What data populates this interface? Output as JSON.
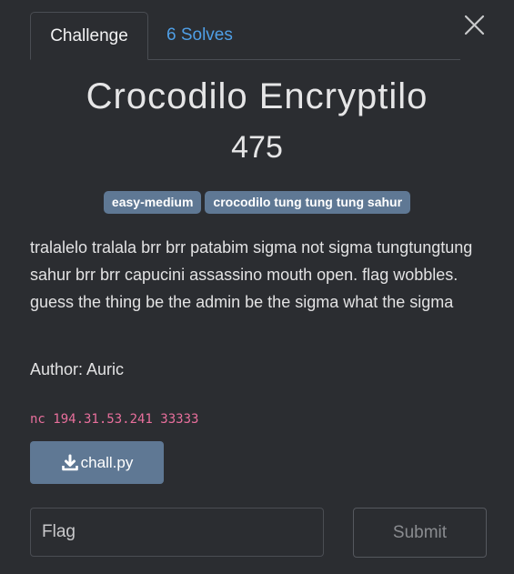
{
  "tabs": {
    "challenge_label": "Challenge",
    "solves_label": "6 Solves"
  },
  "challenge": {
    "name": "Crocodilo Encryptilo",
    "points": "475",
    "tags": [
      "easy-medium",
      "crocodilo tung tung tung sahur"
    ],
    "description": "tralalelo tralala brr brr patabim sigma not sigma tungtungtung sahur brr brr capucini assassino mouth open. flag wobbles. guess the thing be the admin be the sigma what the sigma",
    "author": "Author: Auric",
    "connection": "nc 194.31.53.241 33333",
    "file_label": "chall.py"
  },
  "form": {
    "flag_placeholder": "Flag",
    "submit_label": "Submit"
  },
  "icons": {
    "close": "close-icon",
    "download": "download-icon"
  },
  "colors": {
    "background": "#2b2d31",
    "link": "#4f9fe6",
    "tag_bg": "#5f7894",
    "connection_text": "#e86f9c"
  }
}
